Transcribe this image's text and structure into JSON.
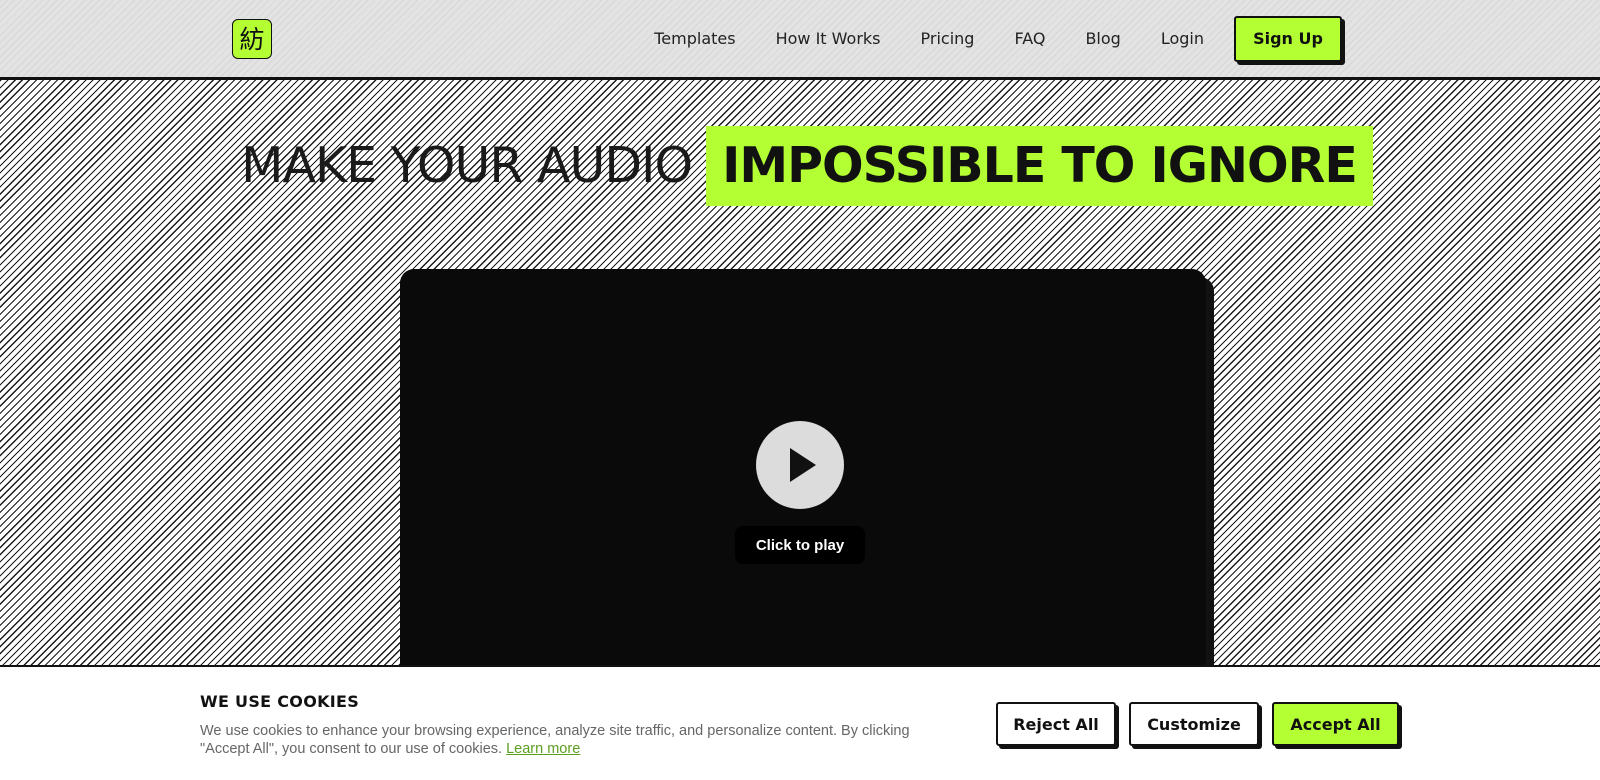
{
  "header": {
    "logo_glyph": "紡",
    "nav": [
      "Templates",
      "How It Works",
      "Pricing",
      "FAQ",
      "Blog",
      "Login"
    ],
    "signup_label": "Sign Up"
  },
  "hero": {
    "headline_plain": "MAKE YOUR AUDIO",
    "headline_highlight": "IMPOSSIBLE TO IGNORE"
  },
  "video": {
    "play_icon": "play-icon",
    "label": "Click to play"
  },
  "cookie_banner": {
    "title": "WE USE COOKIES",
    "text": "We use cookies to enhance your browsing experience, analyze site traffic, and personalize content. By clicking \"Accept All\", you consent to our use of cookies.",
    "learn_more": "Learn more",
    "reject_label": "Reject All",
    "customize_label": "Customize",
    "accept_label": "Accept All"
  },
  "colors": {
    "accent": "#b3ff33",
    "text": "#111111",
    "header_bg": "#e3e3e3",
    "video_bg": "#0a0a0a",
    "link": "#5c9e1f"
  }
}
